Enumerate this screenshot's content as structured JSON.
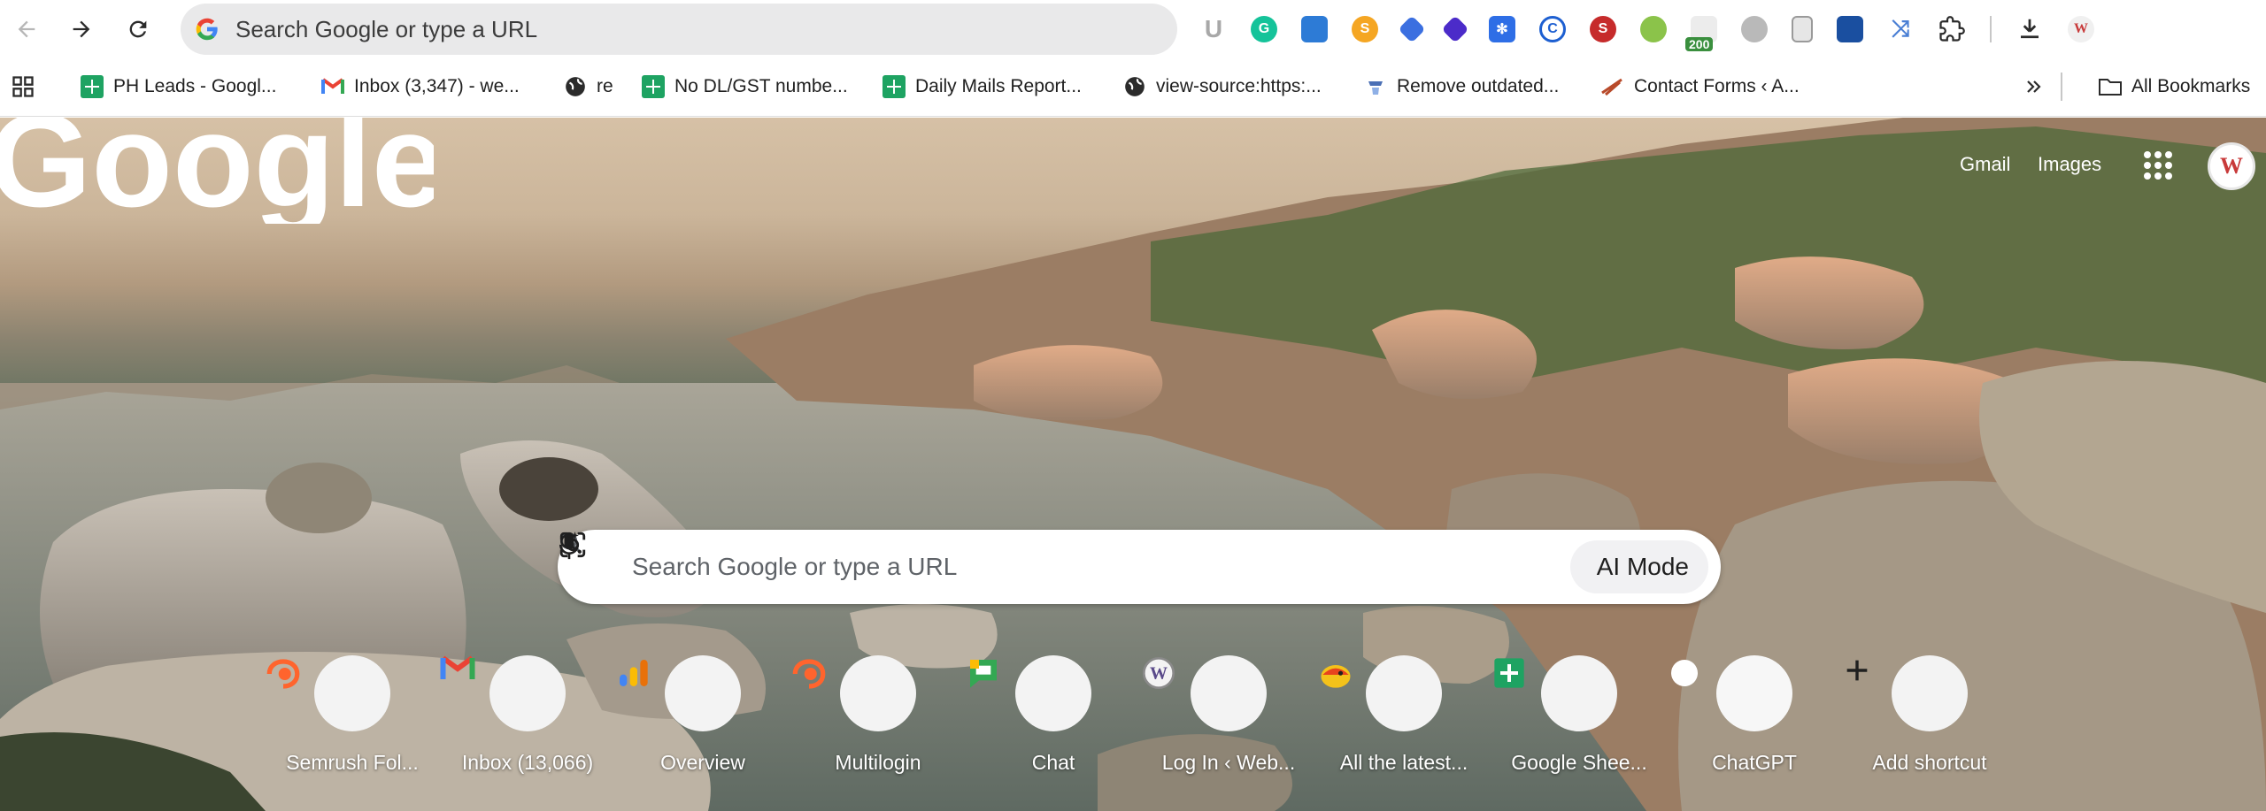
{
  "toolbar": {
    "omnibox_text": "Search Google or type a URL",
    "extensions": [
      {
        "icon": "u-extension-icon",
        "text": "U"
      },
      {
        "icon": "grammarly-icon",
        "text": "G"
      },
      {
        "icon": "puzzle-ext-icon",
        "text": ""
      },
      {
        "icon": "seo-ext-icon",
        "text": "S"
      },
      {
        "icon": "tag-ext-icon",
        "text": ""
      },
      {
        "icon": "diamond-ext-icon",
        "text": ""
      },
      {
        "icon": "gear-ext-icon",
        "text": ""
      },
      {
        "icon": "copyright-ext-icon",
        "text": "C"
      },
      {
        "icon": "seo-quake-icon",
        "text": "S"
      },
      {
        "icon": "leaf-ext-icon",
        "text": ""
      },
      {
        "icon": "status-200-icon",
        "text": "200"
      },
      {
        "icon": "globe-ext-icon",
        "text": ""
      },
      {
        "icon": "doc-ext-icon",
        "text": ""
      },
      {
        "icon": "flag-ext-icon",
        "text": ""
      },
      {
        "icon": "link-ext-icon",
        "text": ""
      }
    ]
  },
  "bookmarks": [
    {
      "label": "PH Leads - Googl...",
      "icon": "sheets-icon"
    },
    {
      "label": "Inbox (3,347) - we...",
      "icon": "gmail-icon"
    },
    {
      "label": "re",
      "icon": "globe-icon"
    },
    {
      "label": "No DL/GST numbe...",
      "icon": "sheets-icon"
    },
    {
      "label": "Daily Mails Report...",
      "icon": "sheets-icon"
    },
    {
      "label": "view-source:https:...",
      "icon": "globe-icon"
    },
    {
      "label": "Remove outdated...",
      "icon": "remove-icon"
    },
    {
      "label": "Contact Forms ‹ A...",
      "icon": "contact-forms-icon"
    }
  ],
  "all_bookmarks_label": "All Bookmarks",
  "header": {
    "gmail": "Gmail",
    "images": "Images",
    "profile_initial": "W"
  },
  "google_logo": "Google",
  "search": {
    "placeholder": "Search Google or type a URL",
    "ai_mode": "AI Mode"
  },
  "shortcuts": [
    {
      "label": "Semrush Fol...",
      "icon": "semrush-icon"
    },
    {
      "label": "Inbox (13,066)",
      "icon": "gmail-icon"
    },
    {
      "label": "Overview",
      "icon": "analytics-icon"
    },
    {
      "label": "Multilogin",
      "icon": "semrush-icon"
    },
    {
      "label": "Chat",
      "icon": "google-chat-icon"
    },
    {
      "label": "Log In ‹ Web...",
      "icon": "wordpress-icon"
    },
    {
      "label": "All the latest...",
      "icon": "bird-icon"
    },
    {
      "label": "Google Shee...",
      "icon": "sheets-icon"
    },
    {
      "label": "ChatGPT",
      "icon": "chatgpt-icon"
    },
    {
      "label": "Add shortcut",
      "icon": "plus-icon"
    }
  ],
  "colors": {
    "sheets_green": "#1ea362",
    "gmail_red": "#ea4335",
    "semrush_orange": "#ff642d",
    "omnibox_bg": "#e9e9ea"
  }
}
